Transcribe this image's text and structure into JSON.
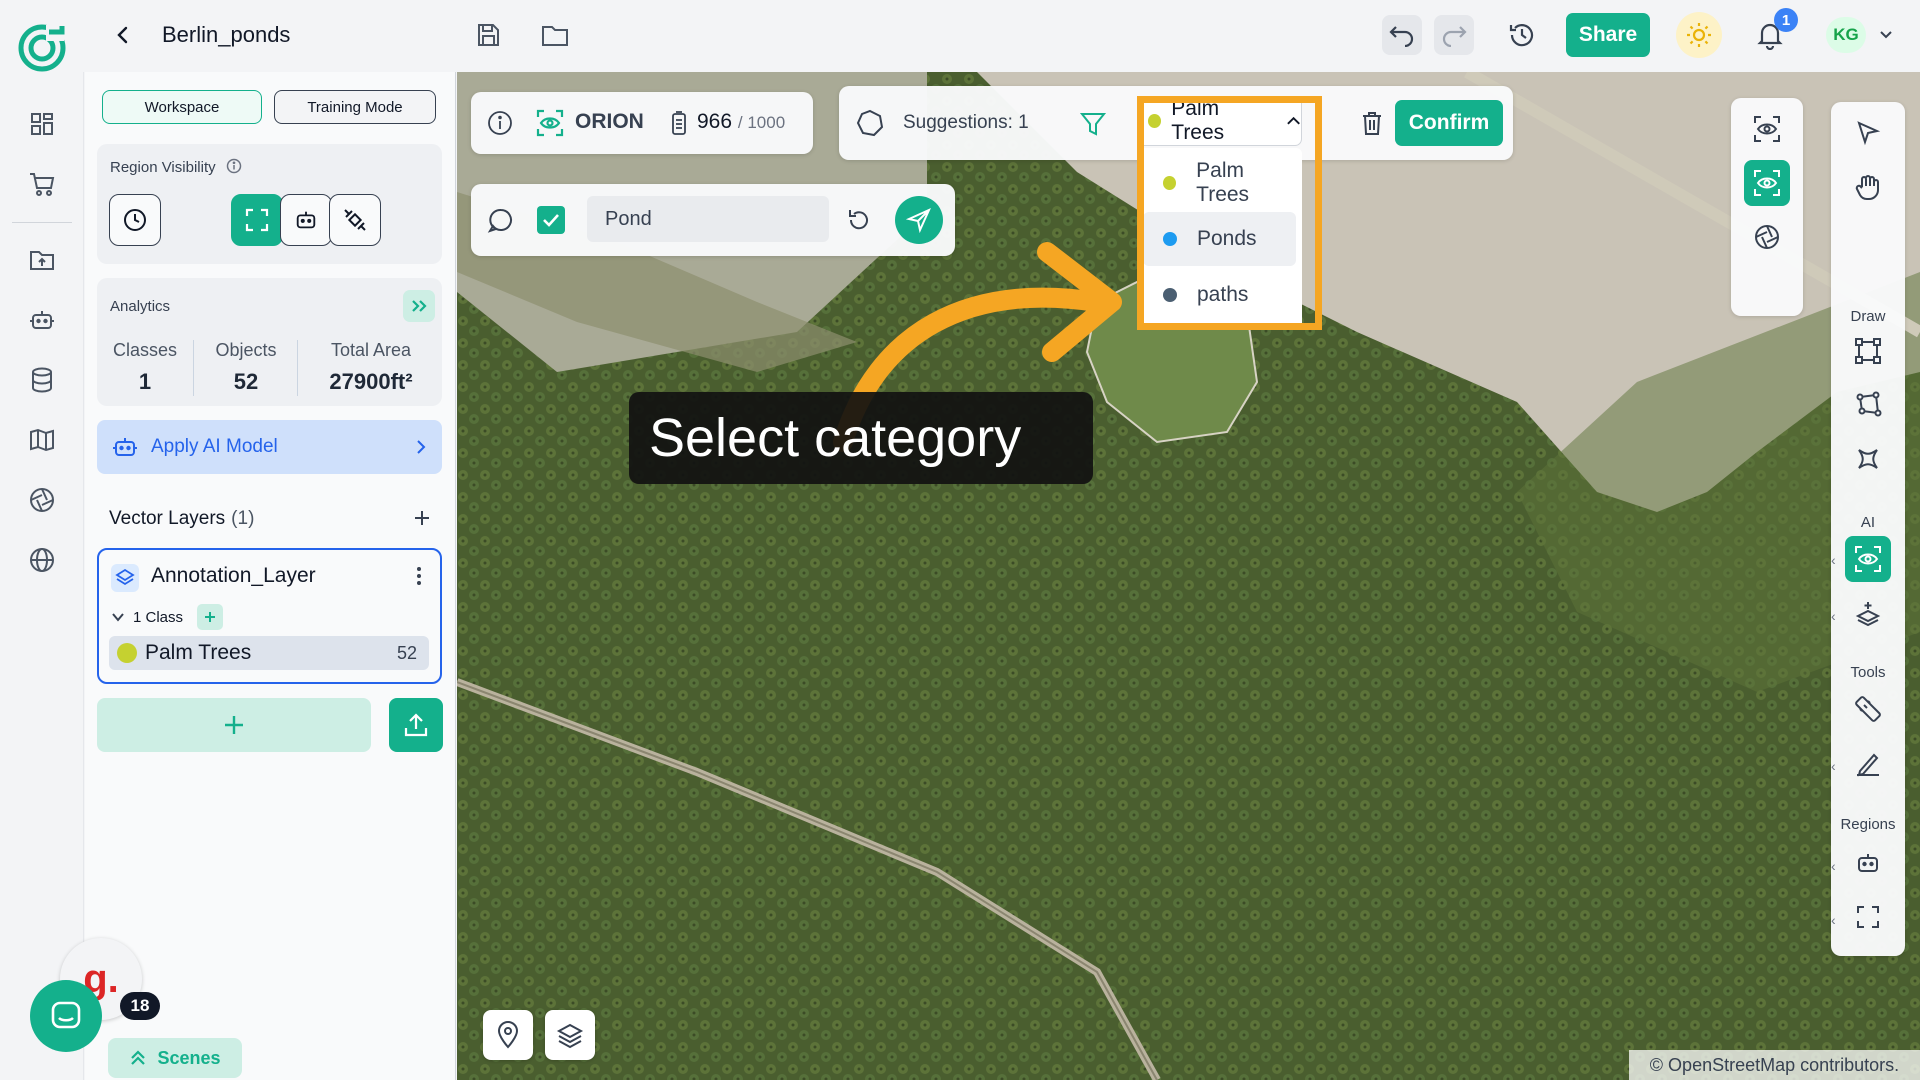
{
  "project": {
    "title": "Berlin_ponds"
  },
  "topbar": {
    "share_label": "Share",
    "notifications_count": "1",
    "user_initials": "KG"
  },
  "panel": {
    "mode_workspace": "Workspace",
    "mode_training": "Training Mode",
    "region_visibility_label": "Region Visibility",
    "analytics_label": "Analytics",
    "stats": {
      "classes_label": "Classes",
      "classes_value": "1",
      "objects_label": "Objects",
      "objects_value": "52",
      "area_label": "Total Area",
      "area_value": "27900ft²"
    },
    "apply_ai_label": "Apply AI Model",
    "vector_layers_label": "Vector Layers",
    "vector_layers_count": "(1)",
    "layer": {
      "name": "Annotation_Layer",
      "class_count_label": "1 Class",
      "class_name": "Palm Trees",
      "class_count": "52",
      "class_color": "#c5d130"
    },
    "scenes_label": "Scenes"
  },
  "map": {
    "orion": {
      "label": "ORION",
      "credits_used": "966",
      "credits_total": "/ 1000"
    },
    "suggestions_label": "Suggestions:",
    "suggestions_count": "1",
    "selected_category": "Palm Trees",
    "categories": [
      {
        "name": "Palm Trees",
        "color": "#c5d130"
      },
      {
        "name": "Ponds",
        "color": "#1d9bf0"
      },
      {
        "name": "paths",
        "color": "#4b5f72"
      }
    ],
    "confirm_label": "Confirm",
    "prompt_value": "Pond",
    "callout_text": "Select category",
    "attribution": "© OpenStreetMap contributors."
  },
  "tools": {
    "draw_label": "Draw",
    "ai_label": "AI",
    "tools_label": "Tools",
    "regions_label": "Regions"
  },
  "chat": {
    "badge_count": "18",
    "g_logo": "g."
  },
  "colors": {
    "accent": "#14b08c",
    "highlight": "#f5a623",
    "link": "#2563eb"
  }
}
